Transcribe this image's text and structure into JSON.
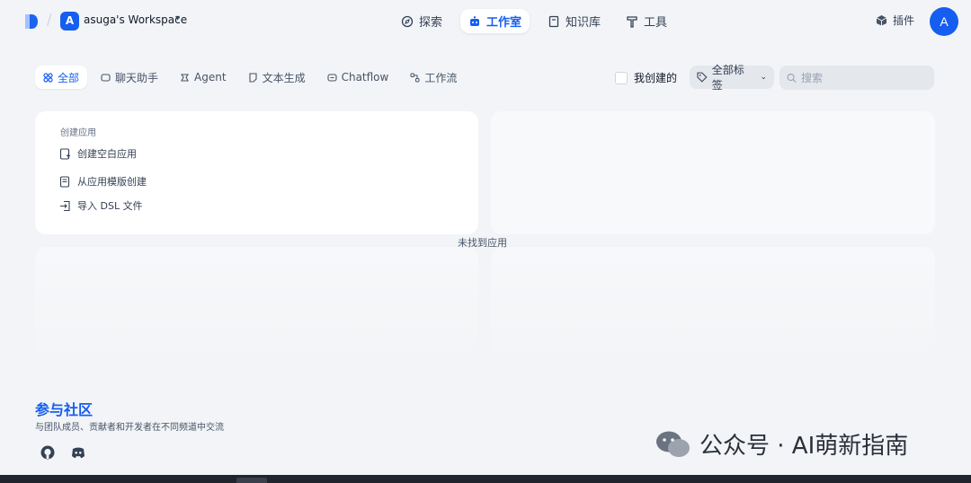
{
  "workspace": {
    "name": "asuga's Workspace",
    "initial": "A"
  },
  "nav": [
    {
      "label": "探索",
      "icon": "compass-icon"
    },
    {
      "label": "工作室",
      "icon": "robot-icon",
      "active": true
    },
    {
      "label": "知识库",
      "icon": "book-icon"
    },
    {
      "label": "工具",
      "icon": "hammer-icon"
    }
  ],
  "header": {
    "plugin_label": "插件",
    "user_initial": "A"
  },
  "tabs": [
    {
      "label": "全部",
      "icon": "grid-icon",
      "active": true
    },
    {
      "label": "聊天助手",
      "icon": "chat-icon"
    },
    {
      "label": "Agent",
      "icon": "agent-icon"
    },
    {
      "label": "文本生成",
      "icon": "document-icon"
    },
    {
      "label": "Chatflow",
      "icon": "chatflow-icon"
    },
    {
      "label": "工作流",
      "icon": "workflow-icon"
    }
  ],
  "filters": {
    "created_by_me": "我创建的",
    "all_tags": "全部标签",
    "search_placeholder": "搜索"
  },
  "create_app": {
    "title": "创建应用",
    "items": [
      {
        "label": "创建空白应用",
        "icon": "file-plus-icon"
      },
      {
        "label": "从应用模版创建",
        "icon": "template-icon"
      },
      {
        "label": "导入 DSL 文件",
        "icon": "import-icon"
      }
    ]
  },
  "empty_message": "未找到应用",
  "community": {
    "title": "参与社区",
    "subtitle": "与团队成员、贡献者和开发者在不同频道中交流"
  },
  "watermark": "公众号 · AI萌新指南",
  "colors": {
    "accent": "#155eef",
    "background": "#f2f4f7"
  }
}
